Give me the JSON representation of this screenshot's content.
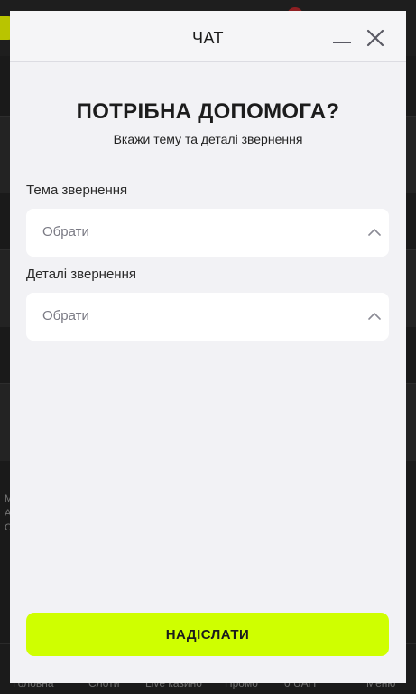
{
  "modal": {
    "title": "ЧАТ",
    "heading": "ПОТРІБНА ДОПОМОГА?",
    "subheading": "Вкажи тему та деталі звернення",
    "fields": [
      {
        "label": "Тема звернення",
        "value": "Обрати"
      },
      {
        "label": "Деталі звернення",
        "value": "Обрати"
      }
    ],
    "submit_label": "НАДІСЛАТИ"
  },
  "background": {
    "side_text": "М А С",
    "bottom_nav": [
      "Головна",
      "Слоти",
      "Live казино",
      "Промо",
      "0 UAH",
      "Меню"
    ]
  },
  "colors": {
    "accent": "#cfff00",
    "modal_bg": "#f2f2f5",
    "backdrop": "#1a1a1a"
  },
  "icons": {
    "minimize": "minimize-icon",
    "close": "close-icon",
    "select_chevron": "chevron-up-icon"
  }
}
